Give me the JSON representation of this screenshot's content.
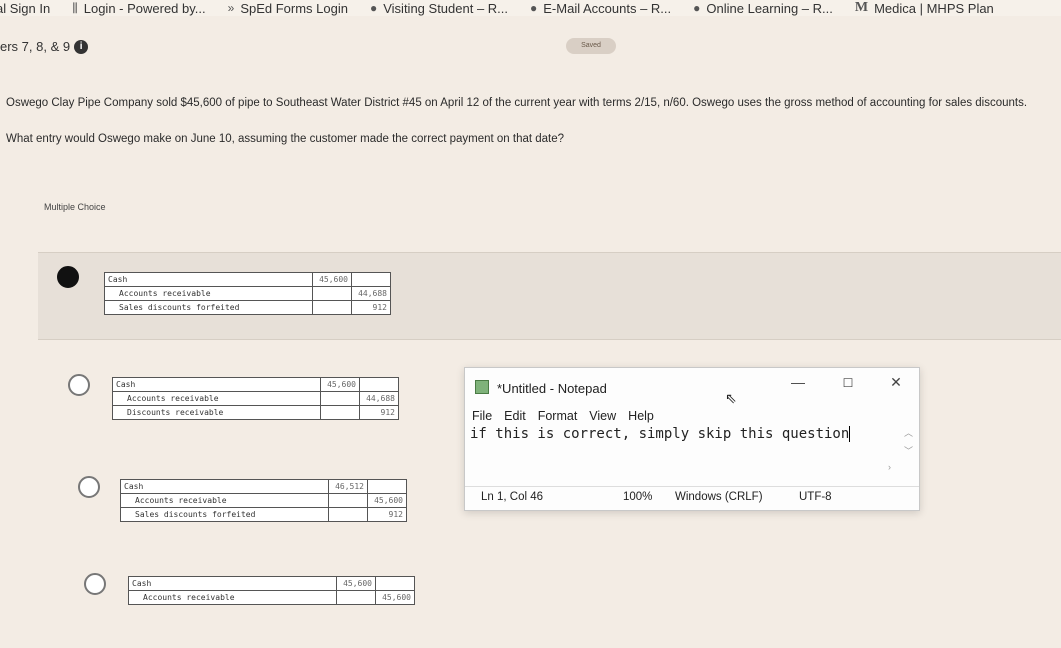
{
  "bookmarks": [
    {
      "label": "al Sign In",
      "icon": ""
    },
    {
      "label": "Login - Powered by...",
      "icon": "columns-icon"
    },
    {
      "label": "SpEd Forms Login",
      "icon": "chevrons-icon"
    },
    {
      "label": "Visiting Student – R...",
      "icon": "globe-icon"
    },
    {
      "label": "E-Mail Accounts – R...",
      "icon": "globe-icon"
    },
    {
      "label": "Online Learning – R...",
      "icon": "globe-icon"
    },
    {
      "label": "Medica | MHPS Plan",
      "icon": "m-logo-icon"
    }
  ],
  "header": {
    "chapter": "ers 7, 8, & 9",
    "saved": "Saved"
  },
  "question": {
    "text": "Oswego Clay Pipe Company sold $45,600 of pipe to Southeast Water District #45 on April 12 of the current year with terms 2/15, n/60. Oswego uses the gross method of accounting for sales discounts.",
    "prompt": "What entry would Oswego make on June 10, assuming the customer made the correct payment on that date?"
  },
  "multiple_choice_label": "Multiple Choice",
  "options": [
    {
      "selected": true,
      "rows": [
        {
          "account": "Cash",
          "debit": "45,600",
          "credit": ""
        },
        {
          "account": "Accounts receivable",
          "debit": "",
          "credit": "44,688"
        },
        {
          "account": "Sales discounts forfeited",
          "debit": "",
          "credit": "912"
        }
      ]
    },
    {
      "selected": false,
      "rows": [
        {
          "account": "Cash",
          "debit": "45,600",
          "credit": ""
        },
        {
          "account": "Accounts receivable",
          "debit": "",
          "credit": "44,688"
        },
        {
          "account": "Discounts receivable",
          "debit": "",
          "credit": "912"
        }
      ]
    },
    {
      "selected": false,
      "rows": [
        {
          "account": "Cash",
          "debit": "46,512",
          "credit": ""
        },
        {
          "account": "Accounts receivable",
          "debit": "",
          "credit": "45,600"
        },
        {
          "account": "Sales discounts forfeited",
          "debit": "",
          "credit": "912"
        }
      ]
    },
    {
      "selected": false,
      "rows": [
        {
          "account": "Cash",
          "debit": "45,600",
          "credit": ""
        },
        {
          "account": "Accounts receivable",
          "debit": "",
          "credit": "45,600"
        }
      ]
    }
  ],
  "notepad": {
    "title": "*Untitled - Notepad",
    "menu": [
      "File",
      "Edit",
      "Format",
      "View",
      "Help"
    ],
    "content": "if this is correct, simply skip this question",
    "status": {
      "position": "Ln 1, Col 46",
      "zoom": "100%",
      "line_ending": "Windows (CRLF)",
      "encoding": "UTF-8"
    },
    "controls": {
      "minimize": "—",
      "maximize": "☐",
      "close": "✕"
    }
  }
}
